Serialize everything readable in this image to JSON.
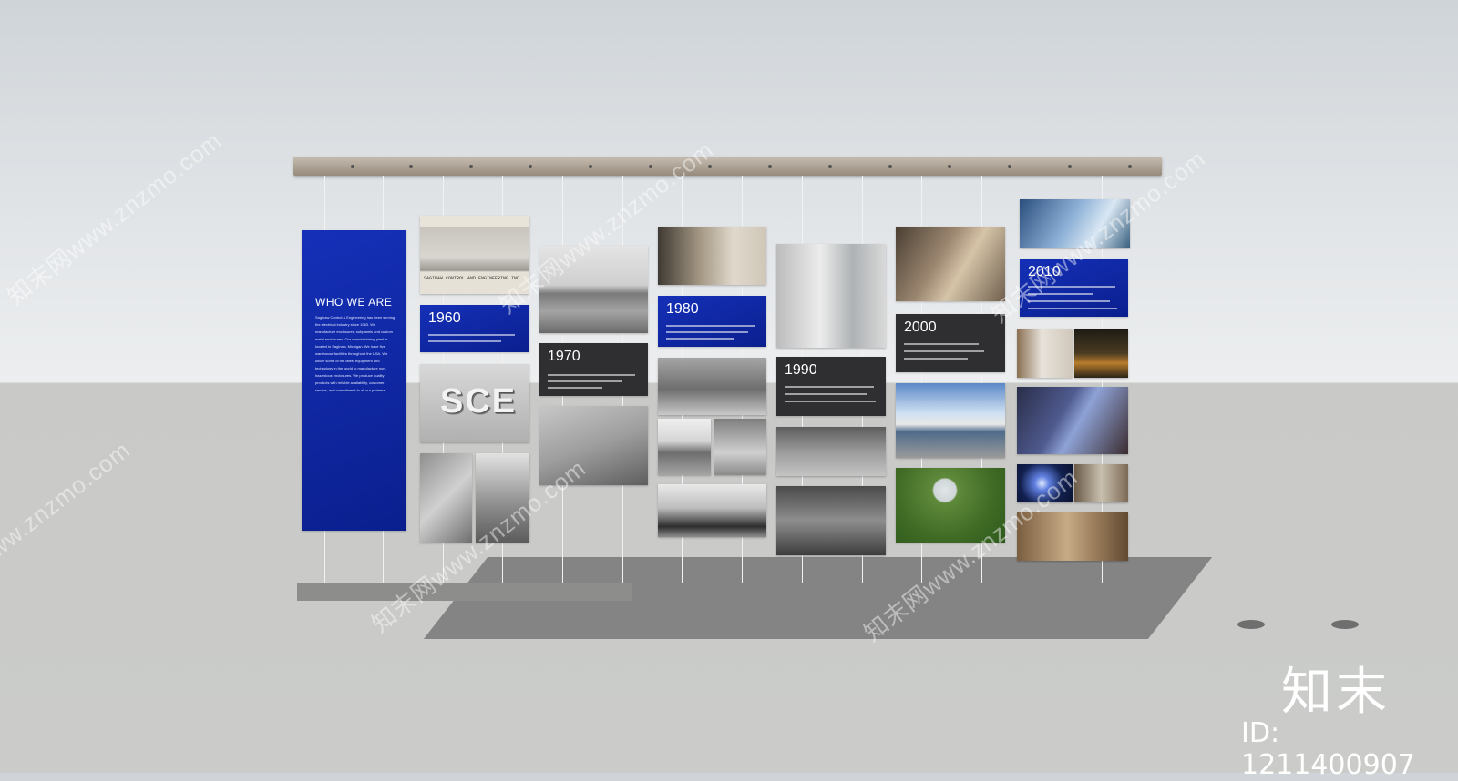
{
  "intro": {
    "title": "WHO WE ARE",
    "body": "Saginaw Control & Engineering has been serving the electrical industry since 1963. We manufacture enclosures, subpanels and custom metal enclosures. Our manufacturing plant is located in Saginaw, Michigan. We have five warehouse facilities throughout the USA. We utilize some of the latest equipment and technology in the world to manufacture non-hazardous enclosures. We produce quality products with reliable availability, customer service, and commitment to all our partners."
  },
  "photo_caption": {
    "line1": "SAGINAW CONTROL AND ENGINEERING INC"
  },
  "timeline": [
    {
      "year": "1960"
    },
    {
      "year": "1970"
    },
    {
      "year": "1980"
    },
    {
      "year": "1990"
    },
    {
      "year": "2000"
    },
    {
      "year": "2010"
    }
  ],
  "sign_letters": "SCE",
  "watermark": {
    "text": "知末网www.znzmo.com",
    "logo": "知末",
    "id_label": "ID: 1211400907"
  },
  "colors": {
    "panel_blue": "#1530b8",
    "panel_dark": "#2f2f31",
    "rail": "#b5aa9c"
  }
}
